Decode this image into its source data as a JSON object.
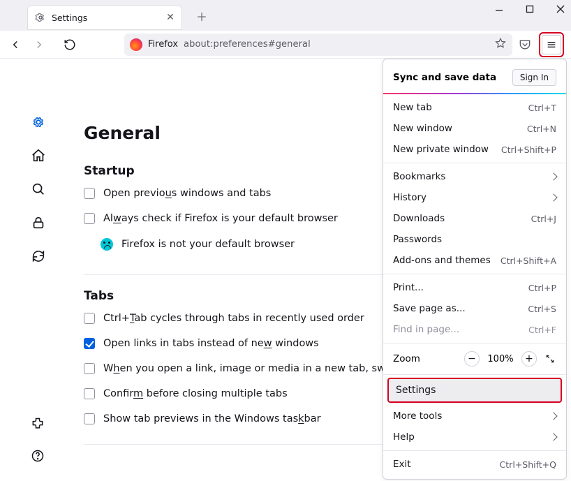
{
  "titlebar": {
    "tab_title": "Settings"
  },
  "urlbar": {
    "product": "Firefox",
    "path": "about:preferences#general"
  },
  "menu": {
    "header": "Sync and save data",
    "sign_in": "Sign In",
    "new_tab": {
      "label": "New tab",
      "shortcut": "Ctrl+T"
    },
    "new_window": {
      "label": "New window",
      "shortcut": "Ctrl+N"
    },
    "new_private": {
      "label": "New private window",
      "shortcut": "Ctrl+Shift+P"
    },
    "bookmarks": {
      "label": "Bookmarks"
    },
    "history": {
      "label": "History"
    },
    "downloads": {
      "label": "Downloads",
      "shortcut": "Ctrl+J"
    },
    "passwords": {
      "label": "Passwords"
    },
    "addons": {
      "label": "Add-ons and themes",
      "shortcut": "Ctrl+Shift+A"
    },
    "print": {
      "label": "Print...",
      "shortcut": "Ctrl+P"
    },
    "save_as": {
      "label": "Save page as...",
      "shortcut": "Ctrl+S"
    },
    "find": {
      "label": "Find in page...",
      "shortcut": "Ctrl+F"
    },
    "zoom": {
      "label": "Zoom",
      "value": "100%"
    },
    "settings": {
      "label": "Settings"
    },
    "more_tools": {
      "label": "More tools"
    },
    "help": {
      "label": "Help"
    },
    "exit": {
      "label": "Exit",
      "shortcut": "Ctrl+Shift+Q"
    }
  },
  "page": {
    "title": "General",
    "startup": {
      "heading": "Startup",
      "open_prev_pre": "Open previo",
      "open_prev_u": "u",
      "open_prev_post": "s windows and tabs",
      "default_pre": "Al",
      "default_u": "w",
      "default_post": "ays check if Firefox is your default browser",
      "not_default": "Firefox is not your default browser"
    },
    "tabs": {
      "heading": "Tabs",
      "ctrltab_pre": "Ctrl+",
      "ctrltab_u": "T",
      "ctrltab_post": "ab cycles through tabs in recently used order",
      "openlinks_pre": "Open links in tabs instead of ne",
      "openlinks_u": "w",
      "openlinks_post": " windows",
      "switchto_pre": "W",
      "switchto_u": "h",
      "switchto_post": "en you open a link, image or media in a new tab, switch t",
      "confirm_pre": "Confir",
      "confirm_u": "m",
      "confirm_post": " before closing multiple tabs",
      "taskbar_pre": "Show tab previews in the Windows tas",
      "taskbar_u": "k",
      "taskbar_post": "bar"
    }
  }
}
